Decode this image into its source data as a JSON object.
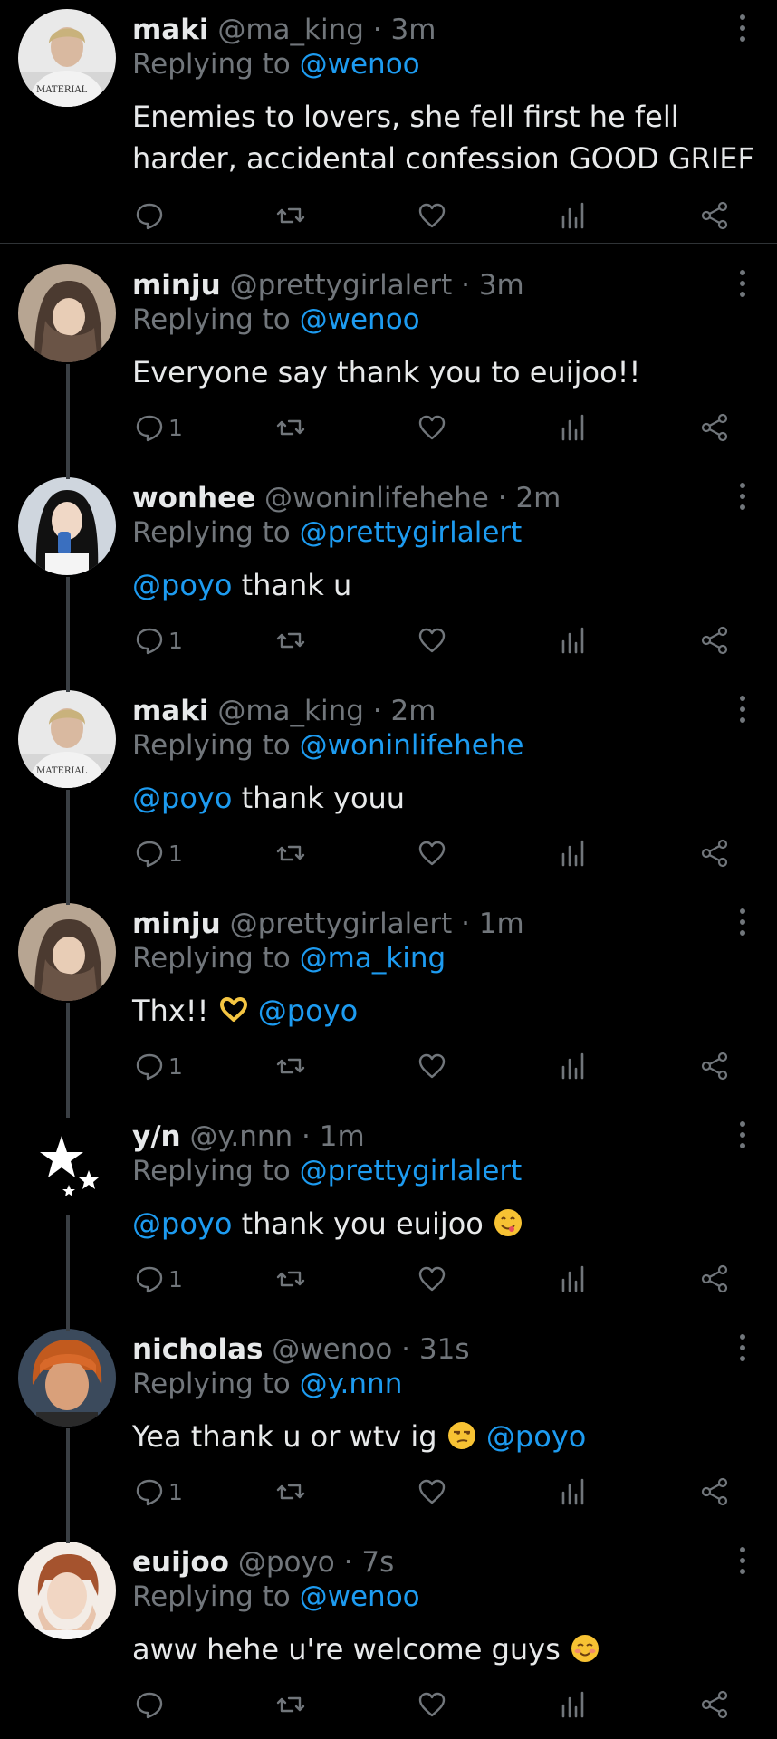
{
  "colors": {
    "background": "#000000",
    "text": "#e7e9ea",
    "secondary": "#71767b",
    "mention": "#1d9bf0",
    "thread_line": "#3a3f44"
  },
  "icons": {
    "reply": "reply-icon",
    "retweet": "retweet-icon",
    "like": "heart-icon",
    "views": "views-icon",
    "share": "share-icon",
    "more": "more-vertical-icon"
  },
  "tweets": [
    {
      "name": "maki",
      "handle": "@ma_king",
      "time": "3m",
      "replying_prefix": "Replying to ",
      "replying_to": "@wenoo",
      "text": "Enemies to lovers, she fell first he fell harder, accidental confession GOOD GRIEF",
      "reply_count": ""
    },
    {
      "name": "minju",
      "handle": "@prettygirlalert",
      "time": "3m",
      "replying_prefix": "Replying to ",
      "replying_to": "@wenoo",
      "text": "Everyone say thank you to euijoo!!",
      "reply_count": "1"
    },
    {
      "name": "wonhee",
      "handle": "@woninlifehehe",
      "time": "2m",
      "replying_prefix": "Replying to ",
      "replying_to": "@prettygirlalert",
      "mention": "@poyo",
      "text": " thank u",
      "reply_count": "1"
    },
    {
      "name": "maki",
      "handle": "@ma_king",
      "time": "2m",
      "replying_prefix": "Replying to ",
      "replying_to": "@woninlifehehe",
      "mention": "@poyo",
      "text": " thank youu",
      "reply_count": "1"
    },
    {
      "name": "minju",
      "handle": "@prettygirlalert",
      "time": "1m",
      "replying_prefix": "Replying to ",
      "replying_to": "@ma_king",
      "text": "Thx!! ",
      "emoji": "heart-hands-emoji",
      "mention": "@poyo",
      "reply_count": "1"
    },
    {
      "name": "y/n",
      "handle": "@y.nnn",
      "time": "1m",
      "replying_prefix": "Replying to ",
      "replying_to": "@prettygirlalert",
      "mention": "@poyo",
      "text": " thank you euijoo ",
      "emoji": "yum-face-emoji",
      "reply_count": "1"
    },
    {
      "name": "nicholas",
      "handle": "@wenoo",
      "time": "31s",
      "replying_prefix": "Replying to ",
      "replying_to": "@y.nnn",
      "text": "Yea thank u or wtv ig ",
      "emoji": "unamused-face-emoji",
      "mention": "@poyo",
      "reply_count": "1"
    },
    {
      "name": "euijoo",
      "handle": "@poyo",
      "time": "7s",
      "replying_prefix": "Replying to ",
      "replying_to": "@wenoo",
      "text": "aww hehe u're welcome guys ",
      "emoji": "smiling-blush-emoji",
      "reply_count": ""
    }
  ],
  "separator": " · "
}
